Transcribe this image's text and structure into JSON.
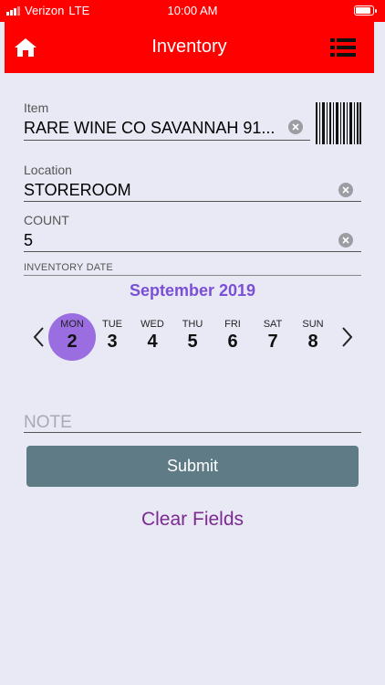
{
  "status_bar": {
    "carrier": "Verizon",
    "network": "LTE",
    "time": "10:00 AM"
  },
  "header": {
    "title": "Inventory",
    "home_icon": "home-icon",
    "menu_icon": "list-icon",
    "color": "#ff0000"
  },
  "form": {
    "item": {
      "label": "Item",
      "value": "RARE WINE CO SAVANNAH 91..."
    },
    "location": {
      "label": "Location",
      "value": "STOREROOM"
    },
    "count": {
      "label": "COUNT",
      "value": "5"
    },
    "inventory_date": {
      "label": "INVENTORY DATE"
    },
    "note": {
      "placeholder": "NOTE"
    }
  },
  "calendar": {
    "month": "September 2019",
    "days": [
      {
        "name": "MON",
        "num": "2",
        "selected": true
      },
      {
        "name": "TUE",
        "num": "3"
      },
      {
        "name": "WED",
        "num": "4"
      },
      {
        "name": "THU",
        "num": "5"
      },
      {
        "name": "FRI",
        "num": "6"
      },
      {
        "name": "SAT",
        "num": "7"
      },
      {
        "name": "SUN",
        "num": "8"
      }
    ],
    "accent": "#9a6ee0"
  },
  "actions": {
    "submit_label": "Submit",
    "clear_label": "Clear Fields",
    "submit_color": "#5f7b85"
  }
}
